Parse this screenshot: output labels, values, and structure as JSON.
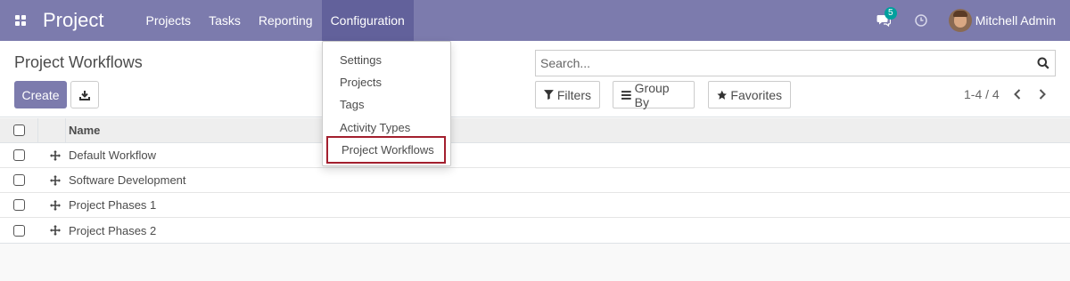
{
  "navbar": {
    "brand": "Project",
    "menu": [
      "Projects",
      "Tasks",
      "Reporting",
      "Configuration"
    ],
    "active_menu": "Configuration",
    "chat_count": "5",
    "user_name": "Mitchell Admin",
    "color": "#7c7bad"
  },
  "control_panel": {
    "title": "Project Workflows",
    "create_label": "Create",
    "search_placeholder": "Search...",
    "filters_label": "Filters",
    "group_by_label": "Group By",
    "favorites_label": "Favorites",
    "pager_value": "1-4 / 4"
  },
  "list": {
    "header_name": "Name",
    "rows": [
      "Default Workflow",
      "Software Development",
      "Project Phases 1",
      "Project Phases 2"
    ]
  },
  "dropdown": {
    "items": [
      "Settings",
      "Projects",
      "Tags",
      "Activity Types",
      "Project Workflows"
    ],
    "highlighted": "Project Workflows",
    "highlight_color": "#a31f2e"
  }
}
